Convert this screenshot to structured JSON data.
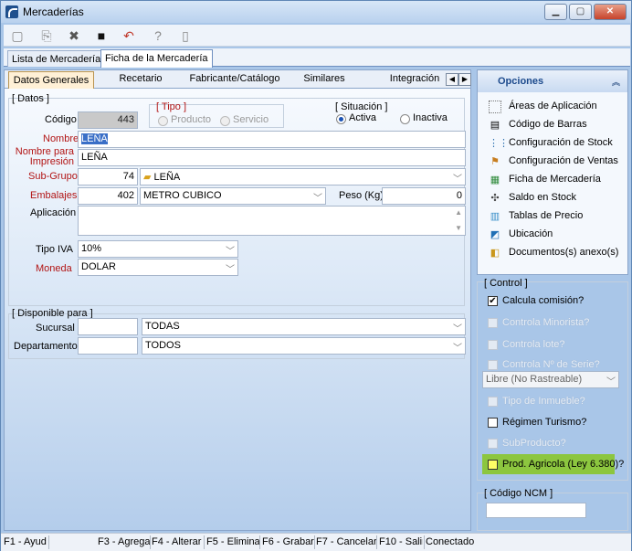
{
  "window": {
    "title": "Mercaderías"
  },
  "outer_tabs": [
    {
      "label": "Lista de Mercaderías"
    },
    {
      "label": "Ficha de la Mercadería"
    }
  ],
  "inner_tabs": [
    {
      "label": "Datos Generales"
    },
    {
      "label": "Recetario"
    },
    {
      "label": "Fabricante/Catálogo"
    },
    {
      "label": "Similares"
    },
    {
      "label": "Integración"
    }
  ],
  "datos": {
    "group_label": "[ Datos ]",
    "codigo_label": "Código",
    "codigo_value": "443",
    "tipo_label": "[ Tipo ]",
    "tipo_producto": "Producto",
    "tipo_servicio": "Servicio",
    "situacion_label": "[ Situación ]",
    "situacion_activa": "Activa",
    "situacion_inactiva": "Inactiva",
    "nombre_label": "Nombre",
    "nombre_value": "LEÑA",
    "nombre_impresion_label_1": "Nombre para",
    "nombre_impresion_label_2": "Impresión",
    "nombre_impresion_value": "LEÑA",
    "subgrupo_label": "Sub-Grupo",
    "subgrupo_code": "74",
    "subgrupo_value": "LEÑA",
    "embalajes_label": "Embalajes",
    "embalajes_code": "402",
    "embalajes_value": "METRO CUBICO",
    "peso_label": "Peso (Kg)",
    "peso_value": "0",
    "aplicacion_label": "Aplicación",
    "tipo_iva_label": "Tipo IVA",
    "tipo_iva_value": "10%",
    "moneda_label": "Moneda",
    "moneda_value": "DOLAR"
  },
  "disponible": {
    "group_label": "[ Disponible para ]",
    "sucursal_label": "Sucursal",
    "sucursal_value": "TODAS",
    "departamento_label": "Departamento",
    "departamento_value": "TODOS"
  },
  "opciones": {
    "title": "Opciones",
    "items": [
      {
        "label": "Áreas de Aplicación",
        "icon": "dotted-square-icon"
      },
      {
        "label": "Código de Barras",
        "icon": "barcode-icon"
      },
      {
        "label": "Configuración de Stock",
        "icon": "stock-config-icon"
      },
      {
        "label": "Configuración de Ventas",
        "icon": "sales-config-icon"
      },
      {
        "label": "Ficha de Mercadería",
        "icon": "product-card-icon"
      },
      {
        "label": "Saldo en Stock",
        "icon": "stock-balance-icon"
      },
      {
        "label": "Tablas de Precio",
        "icon": "price-table-icon"
      },
      {
        "label": "Ubicación",
        "icon": "location-icon"
      },
      {
        "label": "Documentos(s) anexo(s)",
        "icon": "attachment-icon"
      }
    ]
  },
  "control": {
    "group_label": "[ Control ]",
    "calcula_comision": "Calcula comisión?",
    "controla_minorista": "Controla Minorista?",
    "controla_lote": "Controla lote?",
    "controla_serie": "Controla Nº de Serie?",
    "rastreo_value": "Libre (No Rastreable)",
    "tipo_inmueble": "Tipo de Inmueble?",
    "regimen_turismo": "Régimen Turismo?",
    "subproducto": "SubProducto?",
    "prod_agricola": "Prod. Agricola (Ley 6.380)?",
    "highlight_color": "#8cc63f"
  },
  "ncm": {
    "group_label": "[ Código NCM ]",
    "value": ""
  },
  "statusbar": [
    "F1 - Ayud",
    "F3 - Agrega",
    "F4 - Alterar",
    "F5 - Elimina",
    "F6 - Grabar",
    "F7 - Cancelar",
    "F10 - Salir",
    "Conectado"
  ]
}
